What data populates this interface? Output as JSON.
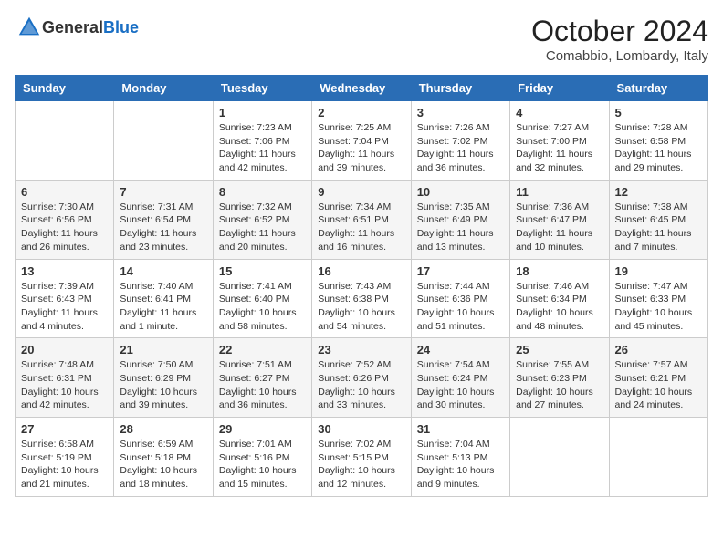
{
  "header": {
    "logo_general": "General",
    "logo_blue": "Blue",
    "month_year": "October 2024",
    "location": "Comabbio, Lombardy, Italy"
  },
  "days_of_week": [
    "Sunday",
    "Monday",
    "Tuesday",
    "Wednesday",
    "Thursday",
    "Friday",
    "Saturday"
  ],
  "weeks": [
    [
      {
        "day": "",
        "content": ""
      },
      {
        "day": "",
        "content": ""
      },
      {
        "day": "1",
        "content": "Sunrise: 7:23 AM\nSunset: 7:06 PM\nDaylight: 11 hours and 42 minutes."
      },
      {
        "day": "2",
        "content": "Sunrise: 7:25 AM\nSunset: 7:04 PM\nDaylight: 11 hours and 39 minutes."
      },
      {
        "day": "3",
        "content": "Sunrise: 7:26 AM\nSunset: 7:02 PM\nDaylight: 11 hours and 36 minutes."
      },
      {
        "day": "4",
        "content": "Sunrise: 7:27 AM\nSunset: 7:00 PM\nDaylight: 11 hours and 32 minutes."
      },
      {
        "day": "5",
        "content": "Sunrise: 7:28 AM\nSunset: 6:58 PM\nDaylight: 11 hours and 29 minutes."
      }
    ],
    [
      {
        "day": "6",
        "content": "Sunrise: 7:30 AM\nSunset: 6:56 PM\nDaylight: 11 hours and 26 minutes."
      },
      {
        "day": "7",
        "content": "Sunrise: 7:31 AM\nSunset: 6:54 PM\nDaylight: 11 hours and 23 minutes."
      },
      {
        "day": "8",
        "content": "Sunrise: 7:32 AM\nSunset: 6:52 PM\nDaylight: 11 hours and 20 minutes."
      },
      {
        "day": "9",
        "content": "Sunrise: 7:34 AM\nSunset: 6:51 PM\nDaylight: 11 hours and 16 minutes."
      },
      {
        "day": "10",
        "content": "Sunrise: 7:35 AM\nSunset: 6:49 PM\nDaylight: 11 hours and 13 minutes."
      },
      {
        "day": "11",
        "content": "Sunrise: 7:36 AM\nSunset: 6:47 PM\nDaylight: 11 hours and 10 minutes."
      },
      {
        "day": "12",
        "content": "Sunrise: 7:38 AM\nSunset: 6:45 PM\nDaylight: 11 hours and 7 minutes."
      }
    ],
    [
      {
        "day": "13",
        "content": "Sunrise: 7:39 AM\nSunset: 6:43 PM\nDaylight: 11 hours and 4 minutes."
      },
      {
        "day": "14",
        "content": "Sunrise: 7:40 AM\nSunset: 6:41 PM\nDaylight: 11 hours and 1 minute."
      },
      {
        "day": "15",
        "content": "Sunrise: 7:41 AM\nSunset: 6:40 PM\nDaylight: 10 hours and 58 minutes."
      },
      {
        "day": "16",
        "content": "Sunrise: 7:43 AM\nSunset: 6:38 PM\nDaylight: 10 hours and 54 minutes."
      },
      {
        "day": "17",
        "content": "Sunrise: 7:44 AM\nSunset: 6:36 PM\nDaylight: 10 hours and 51 minutes."
      },
      {
        "day": "18",
        "content": "Sunrise: 7:46 AM\nSunset: 6:34 PM\nDaylight: 10 hours and 48 minutes."
      },
      {
        "day": "19",
        "content": "Sunrise: 7:47 AM\nSunset: 6:33 PM\nDaylight: 10 hours and 45 minutes."
      }
    ],
    [
      {
        "day": "20",
        "content": "Sunrise: 7:48 AM\nSunset: 6:31 PM\nDaylight: 10 hours and 42 minutes."
      },
      {
        "day": "21",
        "content": "Sunrise: 7:50 AM\nSunset: 6:29 PM\nDaylight: 10 hours and 39 minutes."
      },
      {
        "day": "22",
        "content": "Sunrise: 7:51 AM\nSunset: 6:27 PM\nDaylight: 10 hours and 36 minutes."
      },
      {
        "day": "23",
        "content": "Sunrise: 7:52 AM\nSunset: 6:26 PM\nDaylight: 10 hours and 33 minutes."
      },
      {
        "day": "24",
        "content": "Sunrise: 7:54 AM\nSunset: 6:24 PM\nDaylight: 10 hours and 30 minutes."
      },
      {
        "day": "25",
        "content": "Sunrise: 7:55 AM\nSunset: 6:23 PM\nDaylight: 10 hours and 27 minutes."
      },
      {
        "day": "26",
        "content": "Sunrise: 7:57 AM\nSunset: 6:21 PM\nDaylight: 10 hours and 24 minutes."
      }
    ],
    [
      {
        "day": "27",
        "content": "Sunrise: 6:58 AM\nSunset: 5:19 PM\nDaylight: 10 hours and 21 minutes."
      },
      {
        "day": "28",
        "content": "Sunrise: 6:59 AM\nSunset: 5:18 PM\nDaylight: 10 hours and 18 minutes."
      },
      {
        "day": "29",
        "content": "Sunrise: 7:01 AM\nSunset: 5:16 PM\nDaylight: 10 hours and 15 minutes."
      },
      {
        "day": "30",
        "content": "Sunrise: 7:02 AM\nSunset: 5:15 PM\nDaylight: 10 hours and 12 minutes."
      },
      {
        "day": "31",
        "content": "Sunrise: 7:04 AM\nSunset: 5:13 PM\nDaylight: 10 hours and 9 minutes."
      },
      {
        "day": "",
        "content": ""
      },
      {
        "day": "",
        "content": ""
      }
    ]
  ]
}
